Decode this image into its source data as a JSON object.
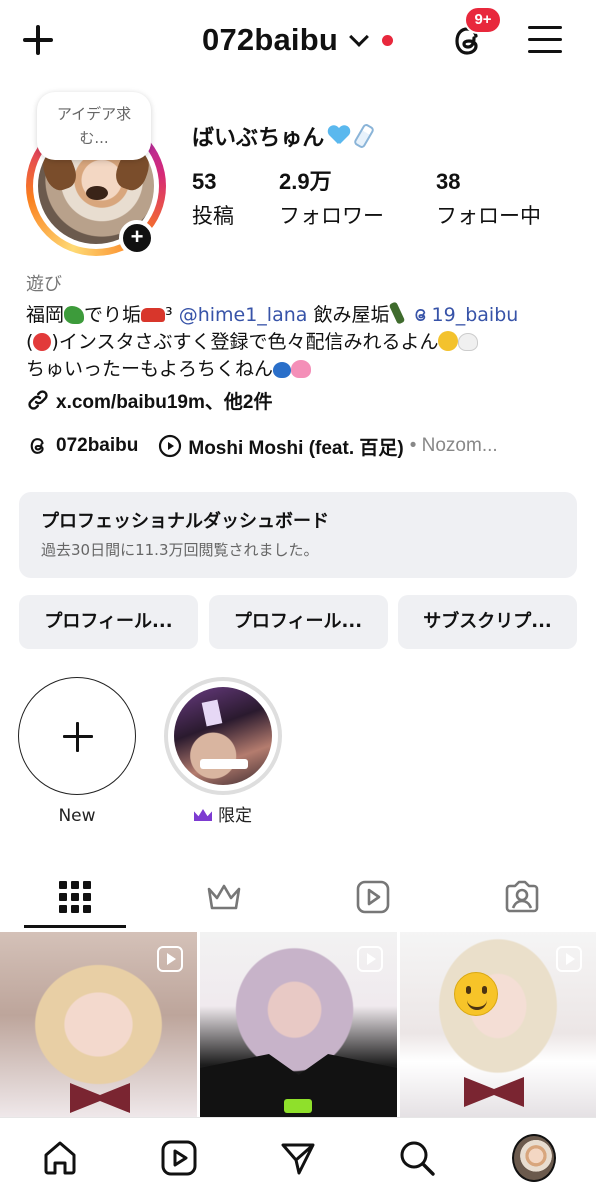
{
  "header": {
    "username": "072baibu",
    "notification_badge": "9+",
    "icons": [
      "plus-icon",
      "chevron-down-icon",
      "threads-icon",
      "menu-icon"
    ]
  },
  "profile": {
    "note": "アイデア求む...",
    "display_name": "ばいぶちゅん",
    "stats": [
      {
        "value": "53",
        "label": "投稿"
      },
      {
        "value": "2.9万",
        "label": "フォロワー"
      },
      {
        "value": "38",
        "label": "フォロー中"
      }
    ],
    "category": "遊び",
    "bio": {
      "line1_a": "福岡",
      "line1_b": "でり垢",
      "line1_sup": "³",
      "line1_mention1": "@hime1_lana",
      "line1_c": "飲み屋垢",
      "line1_mention2": "19_baibu",
      "line2_a": "(",
      "line2_b": ")インスタさぶすく登録で色々配信みれるよん",
      "line3_a": "ちゅいったーもよろちくねん"
    },
    "link": "x.com/baibu19m、他2件",
    "threads_handle": "072baibu",
    "music_title": "Moshi Moshi (feat. 百足)",
    "music_artist": "• Nozom..."
  },
  "dashboard": {
    "title": "プロフェッショナルダッシュボード",
    "subtitle": "過去30日間に11.3万回閲覧されました。"
  },
  "buttons": [
    "プロフィール...",
    "プロフィール...",
    "サブスクリプ..."
  ],
  "highlights": [
    {
      "label": "New"
    },
    {
      "label": "限定"
    }
  ],
  "tabs": [
    "grid-icon",
    "crown-icon",
    "reels-icon",
    "tagged-icon"
  ],
  "posts": [
    {
      "type": "reel"
    },
    {
      "type": "reel"
    },
    {
      "type": "reel"
    }
  ],
  "bottom_nav": [
    "home-icon",
    "reels-icon",
    "send-icon",
    "search-icon",
    "profile-avatar"
  ],
  "colors": {
    "notification_red": "#e8283c",
    "mention_blue": "#3753a8",
    "chip_bg": "#eff0f3",
    "exclusive_purple": "#7d3bd1"
  }
}
